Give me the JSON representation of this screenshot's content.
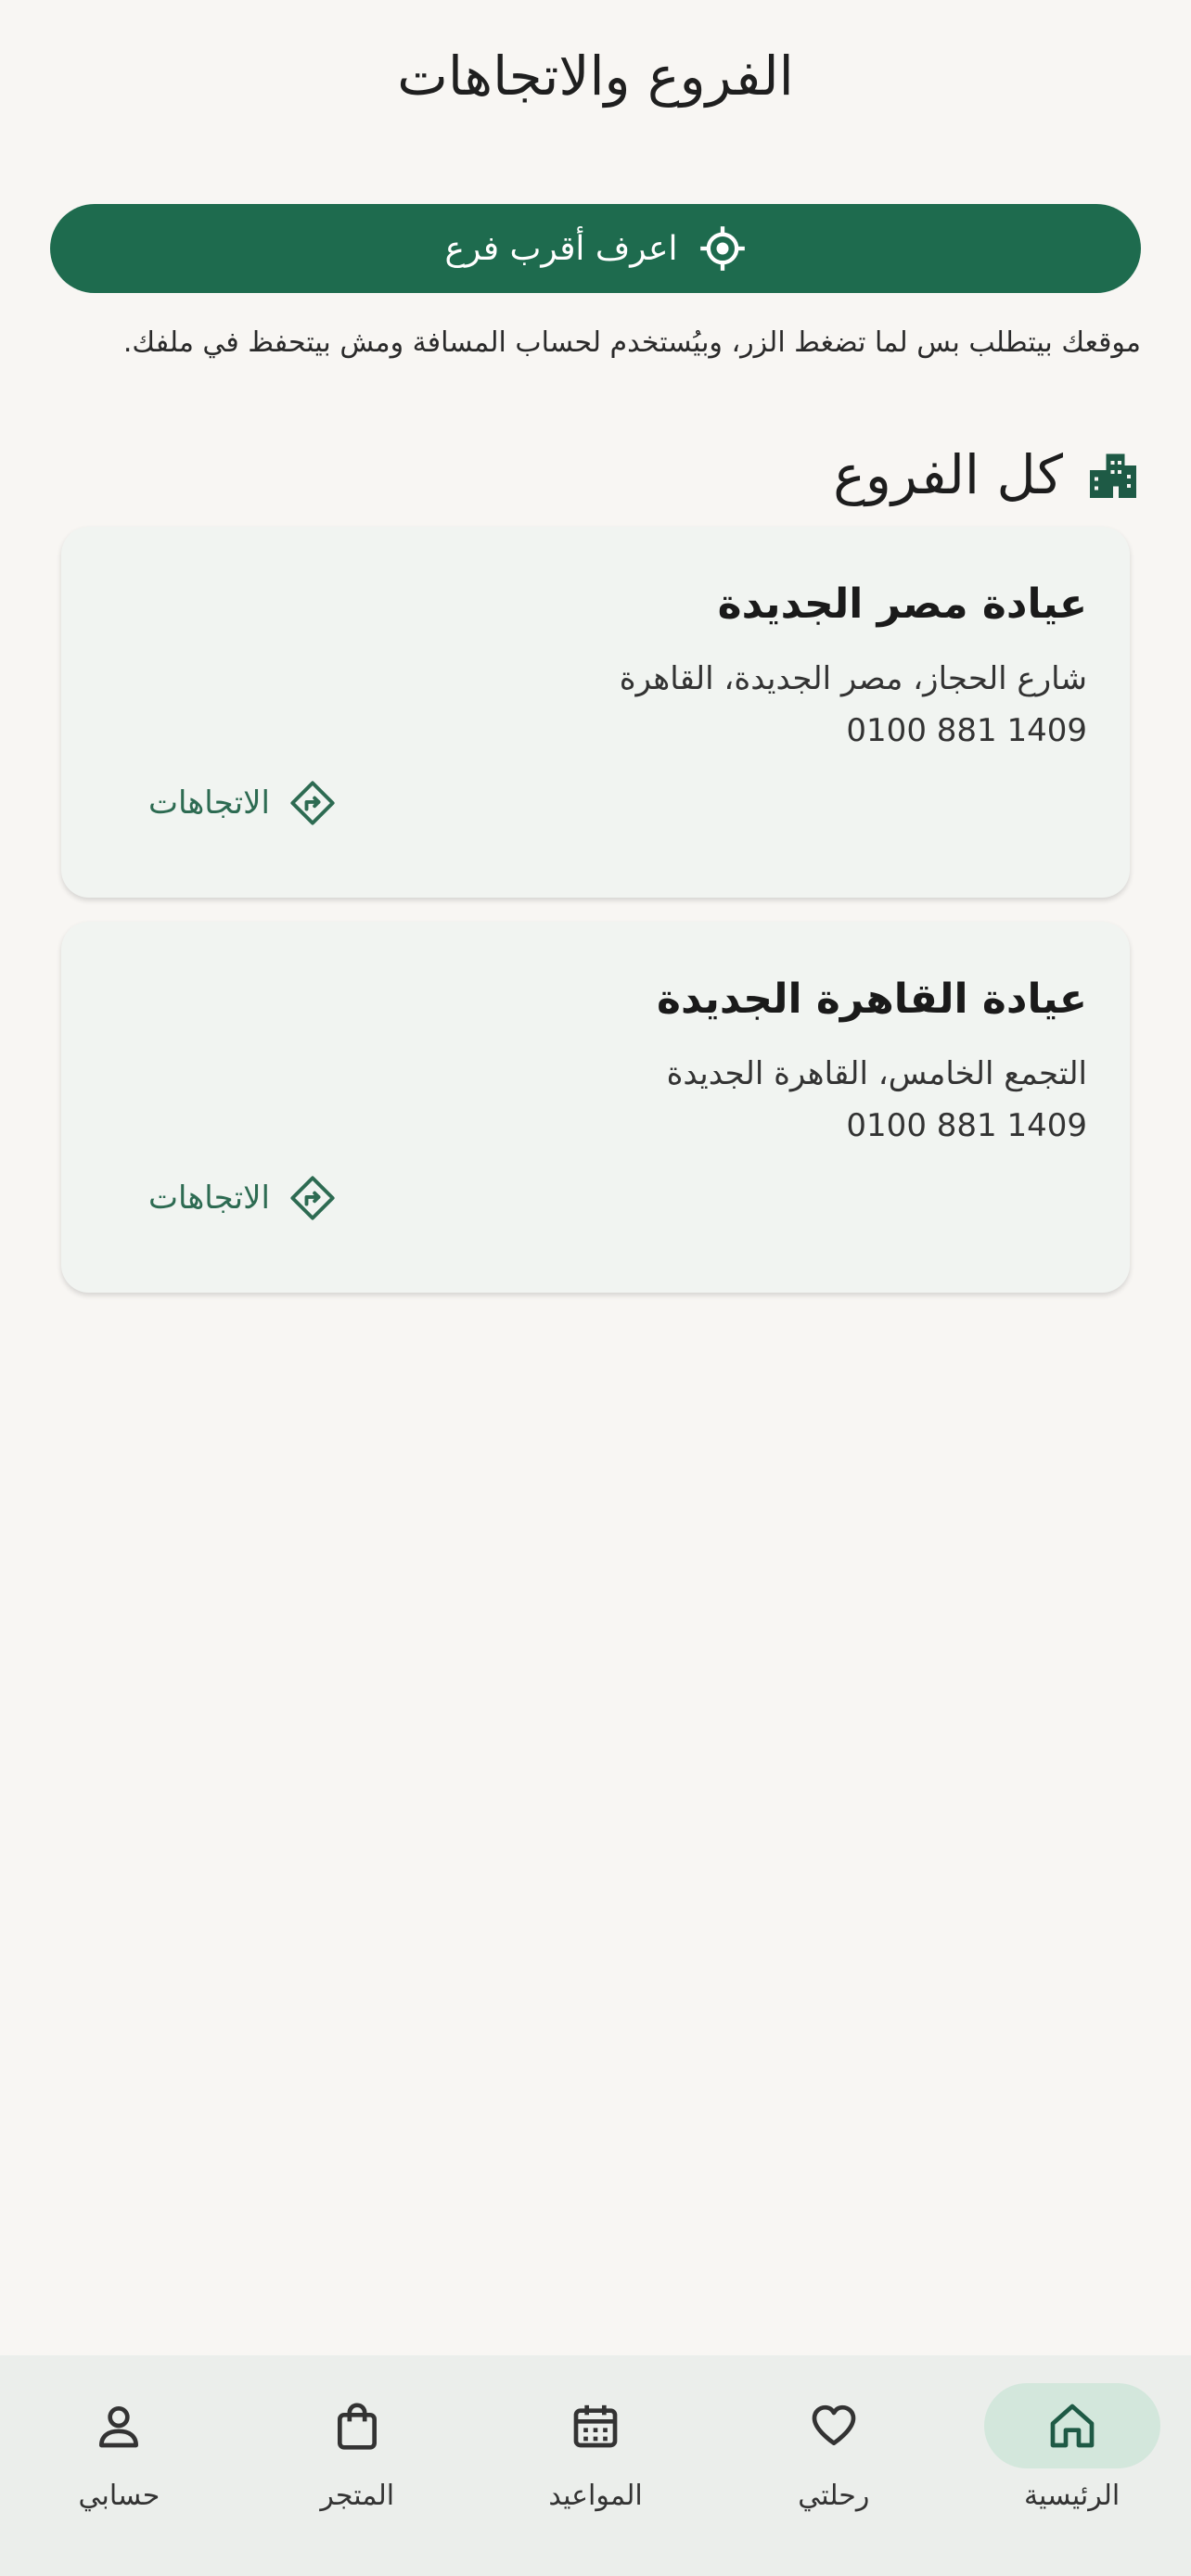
{
  "header": {
    "title": "الفروع والاتجاهات"
  },
  "locate": {
    "button_label": "اعرف أقرب فرع",
    "privacy_note": "موقعك بيتطلب بس لما تضغط الزر، وبيُستخدم لحساب المسافة ومش بيتحفظ في ملفك."
  },
  "section": {
    "title": "كل الفروع",
    "icon": "buildings-icon"
  },
  "branches": [
    {
      "name": "عيادة مصر الجديدة",
      "address": "شارع الحجاز، مصر الجديدة، القاهرة",
      "phone": "0100 881 1409",
      "directions_label": "الاتجاهات"
    },
    {
      "name": "عيادة القاهرة الجديدة",
      "address": "التجمع الخامس، القاهرة الجديدة",
      "phone": "0100 881 1409",
      "directions_label": "الاتجاهات"
    }
  ],
  "nav": {
    "items": [
      {
        "label": "الرئيسية",
        "icon": "home-icon",
        "active": true
      },
      {
        "label": "رحلتي",
        "icon": "heart-icon",
        "active": false
      },
      {
        "label": "المواعيد",
        "icon": "calendar-icon",
        "active": false
      },
      {
        "label": "المتجر",
        "icon": "shopping-bag-icon",
        "active": false
      },
      {
        "label": "حسابي",
        "icon": "person-icon",
        "active": false
      }
    ]
  },
  "colors": {
    "primary": "#1e6b4e",
    "background": "#f8f6f3",
    "card": "#f1f4f1",
    "nav_background": "#ebeeeb",
    "nav_active_pill": "#d3e7dc"
  }
}
